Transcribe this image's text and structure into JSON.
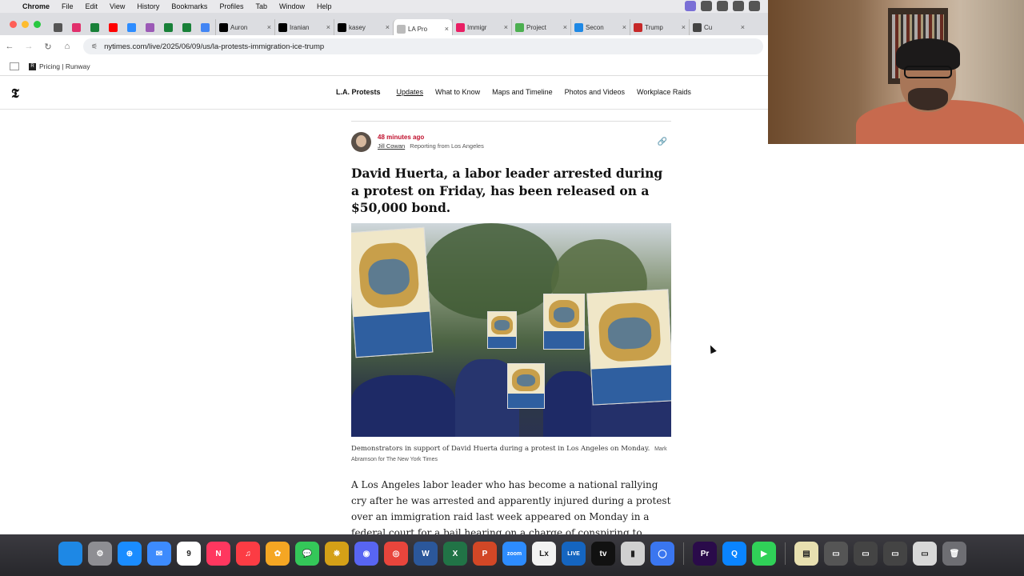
{
  "menubar": {
    "app": "Chrome",
    "items": [
      "File",
      "Edit",
      "View",
      "History",
      "Bookmarks",
      "Profiles",
      "Tab",
      "Window",
      "Help"
    ]
  },
  "tabs": {
    "pinned": [
      {
        "icon": "tab-manager-icon",
        "color": "#555555"
      },
      {
        "icon": "instagram-icon",
        "color": "#e1306c"
      },
      {
        "icon": "google-sheets-icon",
        "color": "#188038"
      },
      {
        "icon": "youtube-icon",
        "color": "#ff0000"
      },
      {
        "icon": "app-icon",
        "color": "#2d8cff"
      },
      {
        "icon": "podcast-icon",
        "color": "#9b59b6"
      },
      {
        "icon": "google-sheets-icon",
        "color": "#188038"
      },
      {
        "icon": "google-sheets-icon",
        "color": "#188038"
      },
      {
        "icon": "google-docs-icon",
        "color": "#4285f4"
      }
    ],
    "open": [
      {
        "title": "Auron",
        "icon": "x-icon",
        "color": "#000000",
        "active": false
      },
      {
        "title": "Iranian",
        "icon": "x-icon",
        "color": "#000000",
        "active": false
      },
      {
        "title": "kasey",
        "icon": "x-icon",
        "color": "#000000",
        "active": false
      },
      {
        "title": "LA Pro",
        "icon": "nyt-icon",
        "color": "#bbbbbb",
        "active": true
      },
      {
        "title": "Immigr",
        "icon": "f-icon",
        "color": "#e91e63",
        "active": false
      },
      {
        "title": "Project",
        "icon": "globe-icon",
        "color": "#4caf50",
        "active": false
      },
      {
        "title": "Secon",
        "icon": "s-icon",
        "color": "#1e88e5",
        "active": false
      },
      {
        "title": "Trump",
        "icon": "p-icon",
        "color": "#c62828",
        "active": false
      },
      {
        "title": "Cu",
        "icon": "pin-icon",
        "color": "#444444",
        "active": false
      }
    ]
  },
  "toolbar": {
    "url": "nytimes.com/live/2025/06/09/us/la-protests-immigration-ice-trump"
  },
  "bookmarks": [
    {
      "label": "Pricing | Runway",
      "icon": "runway-icon"
    }
  ],
  "site": {
    "logo": "𝕿",
    "section": "L.A. Protests",
    "nav": [
      {
        "label": "Updates",
        "active": true
      },
      {
        "label": "What to Know",
        "active": false
      },
      {
        "label": "Maps and Timeline",
        "active": false
      },
      {
        "label": "Photos and Videos",
        "active": false
      },
      {
        "label": "Workplace Raids",
        "active": false
      }
    ]
  },
  "article": {
    "timestamp": "48 minutes ago",
    "author": "Jill Cowan",
    "reporting": "Reporting from Los Angeles",
    "headline": "David Huerta, a labor leader arrested during a protest on Friday, has been released on a $50,000 bond.",
    "caption": "Demonstrators in support of David Huerta during a protest in Los Angeles on Monday.",
    "credit": "Mark Abramson for The New York Times",
    "body": "A Los Angeles labor leader who has become a national rallying cry after he was arrested and apparently injured during a protest over an immigration raid last week appeared on Monday in a federal court for a bail hearing on a charge of conspiring to impede an"
  },
  "dock": [
    {
      "name": "finder-icon",
      "color": "#1e88e5",
      "glyph": ""
    },
    {
      "name": "system-settings-icon",
      "color": "#8e8e93",
      "glyph": "⚙"
    },
    {
      "name": "safari-icon",
      "color": "#1a8cff",
      "glyph": "⊕"
    },
    {
      "name": "mail-icon",
      "color": "#3d8bfd",
      "glyph": "✉"
    },
    {
      "name": "calendar-icon",
      "color": "#ffffff",
      "glyph": "9"
    },
    {
      "name": "news-icon",
      "color": "#ff375f",
      "glyph": "N"
    },
    {
      "name": "music-icon",
      "color": "#fc3c44",
      "glyph": "♫"
    },
    {
      "name": "photos-icon",
      "color": "#f5a623",
      "glyph": "✿"
    },
    {
      "name": "messages-icon",
      "color": "#34c759",
      "glyph": "💬"
    },
    {
      "name": "butterfly-app-icon",
      "color": "#d4a017",
      "glyph": "❋"
    },
    {
      "name": "discord-icon",
      "color": "#5865f2",
      "glyph": "◉"
    },
    {
      "name": "chrome-icon",
      "color": "#e8453c",
      "glyph": "◎"
    },
    {
      "name": "word-icon",
      "color": "#2b579a",
      "glyph": "W"
    },
    {
      "name": "excel-icon",
      "color": "#217346",
      "glyph": "X"
    },
    {
      "name": "powerpoint-icon",
      "color": "#d24726",
      "glyph": "P"
    },
    {
      "name": "zoom-icon",
      "color": "#2d8cff",
      "glyph": "zoom"
    },
    {
      "name": "lexis-icon",
      "color": "#f2f2f2",
      "glyph": "Lx"
    },
    {
      "name": "live-app-icon",
      "color": "#1565c0",
      "glyph": "LIVE"
    },
    {
      "name": "apple-tv-icon",
      "color": "#111111",
      "glyph": "tv"
    },
    {
      "name": "notes-app-icon",
      "color": "#d0d0d0",
      "glyph": "▮"
    },
    {
      "name": "signal-icon",
      "color": "#3a76f0",
      "glyph": "◯"
    },
    {
      "name": "premiere-icon",
      "color": "#2a0b4a",
      "glyph": "Pr"
    },
    {
      "name": "quicktime-icon",
      "color": "#0a84ff",
      "glyph": "Q"
    },
    {
      "name": "facetime-icon",
      "color": "#30d158",
      "glyph": "▶"
    },
    {
      "name": "document-preview-icon",
      "color": "#e8e0b0",
      "glyph": "▤"
    },
    {
      "name": "window-thumbnail-icon",
      "color": "#555555",
      "glyph": "▭"
    },
    {
      "name": "window-thumbnail-icon",
      "color": "#444444",
      "glyph": "▭"
    },
    {
      "name": "window-thumbnail-icon",
      "color": "#444444",
      "glyph": "▭"
    },
    {
      "name": "window-thumbnail-icon",
      "color": "#d8d8d8",
      "glyph": "▭"
    },
    {
      "name": "trash-icon",
      "color": "#6e6e73",
      "glyph": "🗑"
    }
  ]
}
